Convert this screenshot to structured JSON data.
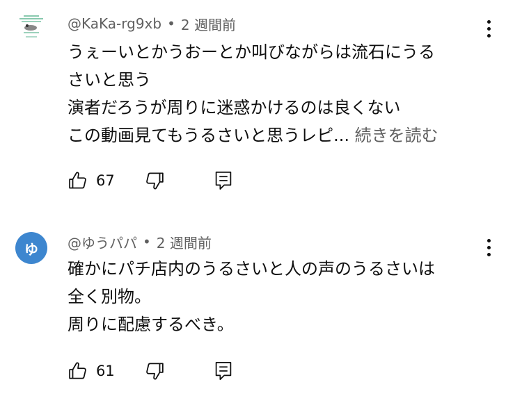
{
  "comments": [
    {
      "author": "@KaKa-rg9xb",
      "separator": "•",
      "time": "2 週間前",
      "lines": [
        "うぇーいとかうおーとか叫びながらは流石にうる",
        "さいと思う",
        "演者だろうが周りに迷惑かけるのは良くない",
        "この動画見てもうるさいと思うレピ..."
      ],
      "read_more": "続きを読む",
      "likes": "67",
      "avatar": {
        "type": "image",
        "bg": "#ffffff"
      }
    },
    {
      "author": "@ゆうパパ",
      "separator": "•",
      "time": "2 週間前",
      "lines": [
        "確かにパチ店内のうるさいと人の声のうるさいは",
        "全く別物。",
        "周りに配慮するべき。"
      ],
      "likes": "61",
      "avatar": {
        "type": "letter",
        "letter": "ゆ",
        "bg": "#3d86cf"
      }
    }
  ],
  "icons": {
    "like": "thumbs-up-icon",
    "dislike": "thumbs-down-icon",
    "reply": "reply-comment-icon",
    "menu": "more-vert-icon"
  }
}
